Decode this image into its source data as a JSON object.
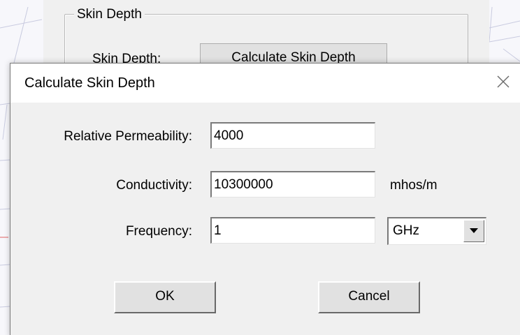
{
  "parent": {
    "group_title": "Skin Depth",
    "field_label": "Skin Depth:",
    "calc_button_label": "Calculate Skin Depth"
  },
  "dialog": {
    "title": "Calculate Skin Depth",
    "close_icon": "close-icon",
    "fields": {
      "permeability": {
        "label": "Relative Permeability:",
        "value": "4000"
      },
      "conductivity": {
        "label": "Conductivity:",
        "value": "10300000",
        "unit": "mhos/m"
      },
      "frequency": {
        "label": "Frequency:",
        "value": "1",
        "unit_selected": "GHz"
      }
    },
    "ok_label": "OK",
    "cancel_label": "Cancel"
  }
}
